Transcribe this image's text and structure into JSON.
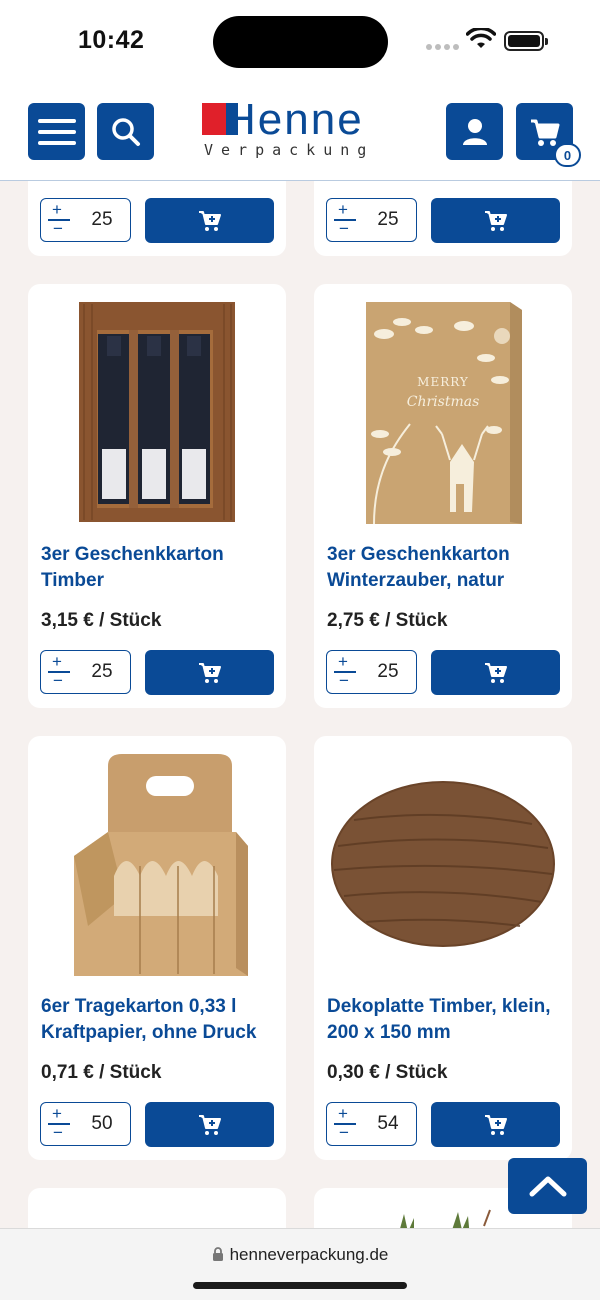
{
  "status_bar": {
    "time": "10:42"
  },
  "header": {
    "logo_word": "Henne",
    "logo_sub": "Verpackung",
    "cart_count": "0"
  },
  "colors": {
    "brand_blue": "#0a4a96",
    "brand_red": "#e0202a",
    "page_bg": "#f6f1ef"
  },
  "products": [
    {
      "title": "",
      "price": "",
      "qty": "25"
    },
    {
      "title": "",
      "price": "",
      "qty": "25"
    },
    {
      "title": "3er Geschenkkarton Timber",
      "price": "3,15 € / Stück",
      "qty": "25"
    },
    {
      "title": "3er Geschenkkarton Winterzauber, natur",
      "price": "2,75 € / Stück",
      "qty": "25"
    },
    {
      "title": "6er Tragekarton 0,33 l Kraftpapier, ohne Druck",
      "price": "0,71 € / Stück",
      "qty": "50"
    },
    {
      "title": "Dekoplatte Timber, klein, 200 x 150 mm",
      "price": "0,30 € / Stück",
      "qty": "54"
    }
  ],
  "product_art": {
    "winter_box_text_1": "MERRY",
    "winter_box_text_2": "Christmas"
  },
  "browser": {
    "url": "henneverpackung.de"
  },
  "icons": {
    "menu": "hamburger-icon",
    "search": "search-icon",
    "account": "user-icon",
    "cart": "cart-icon",
    "add_to_cart": "cart-plus-icon",
    "scroll_top": "chevron-up-icon",
    "lock": "lock-icon"
  }
}
